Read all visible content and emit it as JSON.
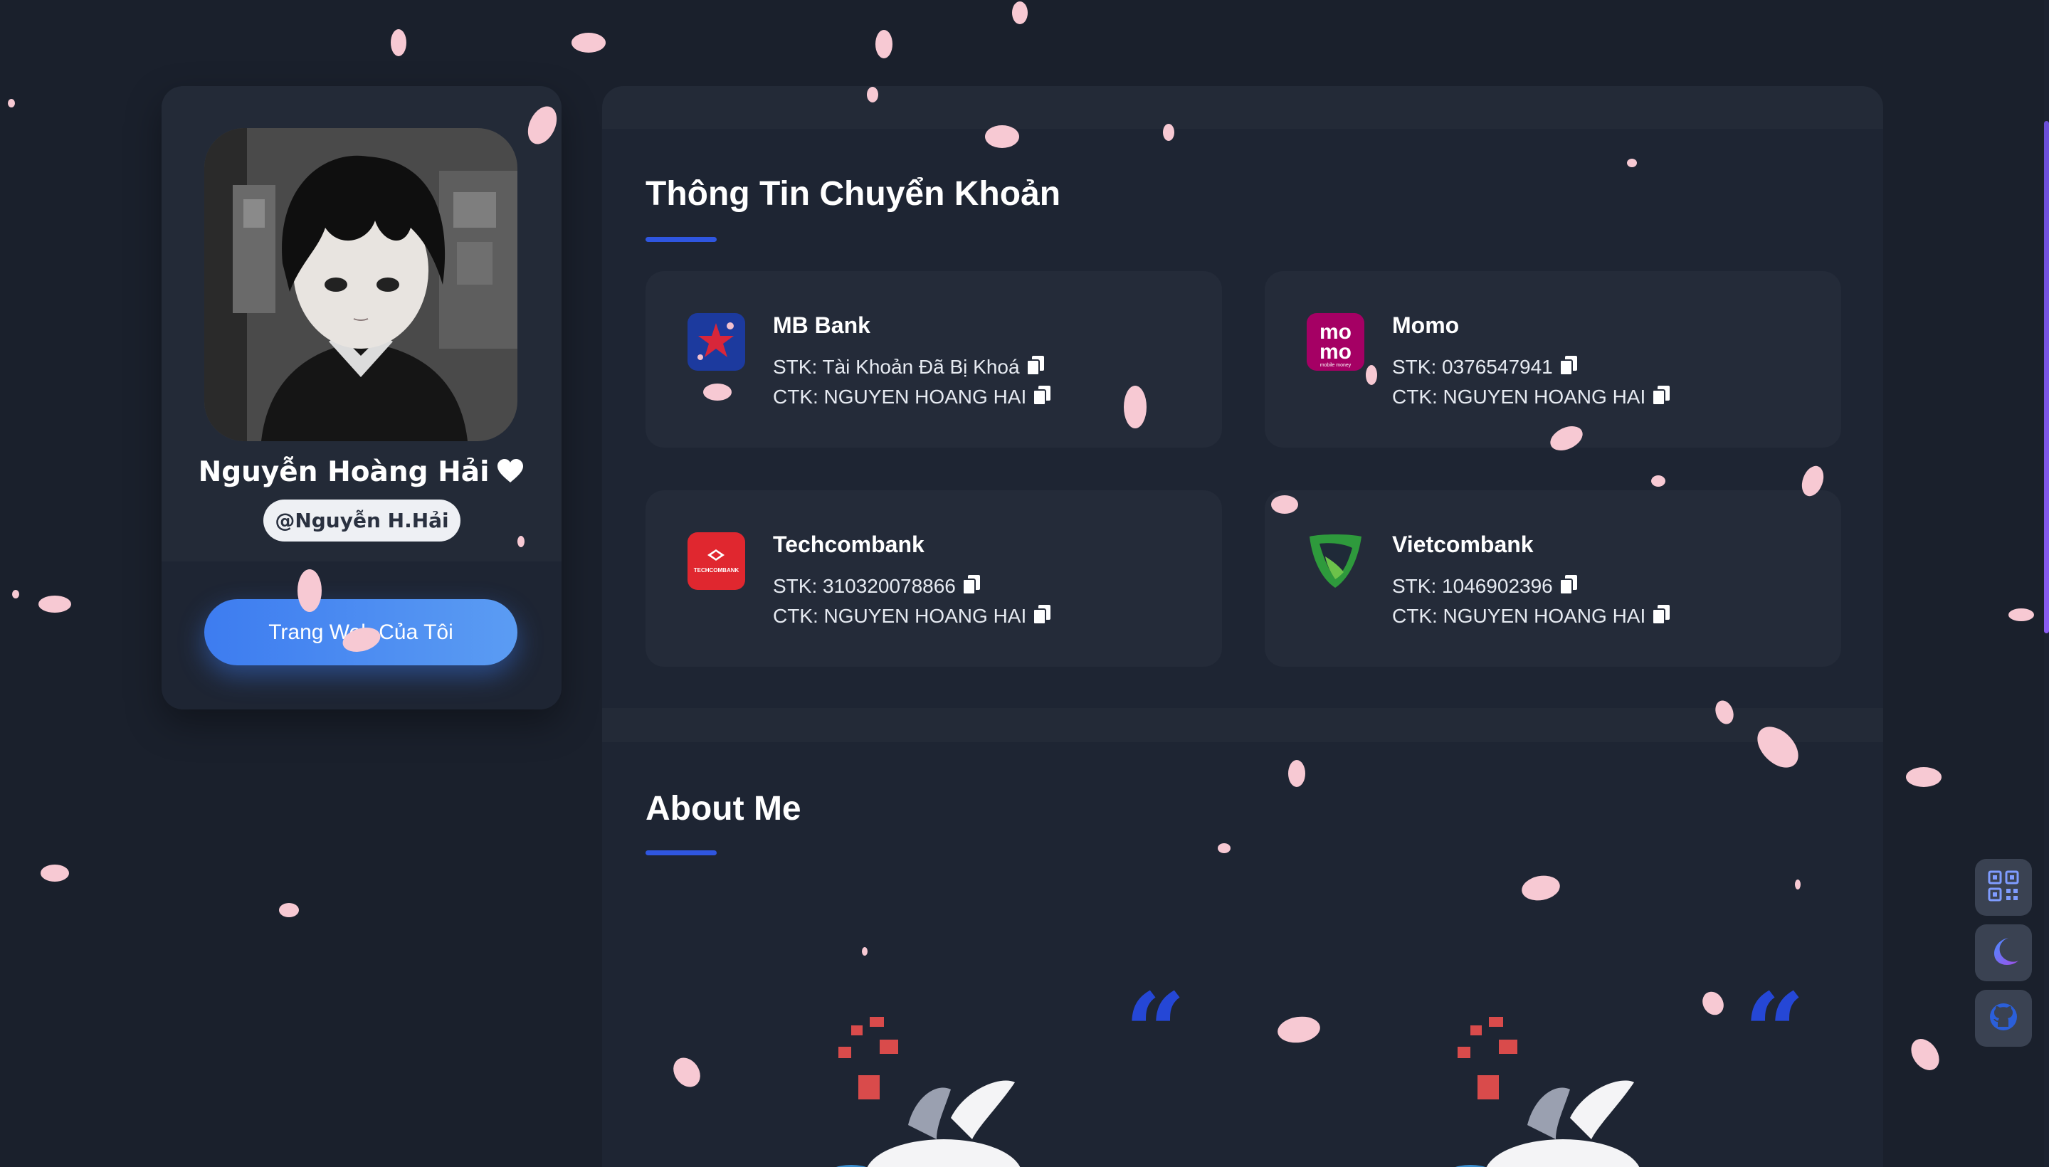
{
  "profile": {
    "name": "Nguyễn Hoàng Hải",
    "handle": "@Nguyễn H.Hải",
    "website_button": "Trang Web Của Tôi"
  },
  "transfer": {
    "title": "Thông Tin Chuyển Khoản",
    "banks": [
      {
        "name": "MB Bank",
        "stk": "STK: Tài Khoản Đã Bị Khoá",
        "ctk": "CTK: NGUYEN HOANG HAI",
        "logo": "mbbank-logo"
      },
      {
        "name": "Momo",
        "stk": "STK: 0376547941",
        "ctk": "CTK: NGUYEN HOANG HAI",
        "logo": "momo-logo"
      },
      {
        "name": "Techcombank",
        "stk": "STK: 310320078866",
        "ctk": "CTK: NGUYEN HOANG HAI",
        "logo": "techcombank-logo"
      },
      {
        "name": "Vietcombank",
        "stk": "STK: 1046902396",
        "ctk": "CTK: NGUYEN HOANG HAI",
        "logo": "vietcombank-logo"
      }
    ]
  },
  "about": {
    "title": "About Me",
    "quote_glyph": "“"
  },
  "logos": {
    "momo_line1": "mo",
    "momo_line2": "mo",
    "momo_sub": "mobile money",
    "techcombank": "TECHCOMBANK"
  },
  "colors": {
    "background": "#1a202c",
    "card": "#1e2533",
    "accent": "#2f56e0",
    "button": "#3d7cf0",
    "petal": "#f7c9d3"
  },
  "floating_buttons": [
    "qr-code-icon",
    "moon-icon",
    "github-icon"
  ]
}
